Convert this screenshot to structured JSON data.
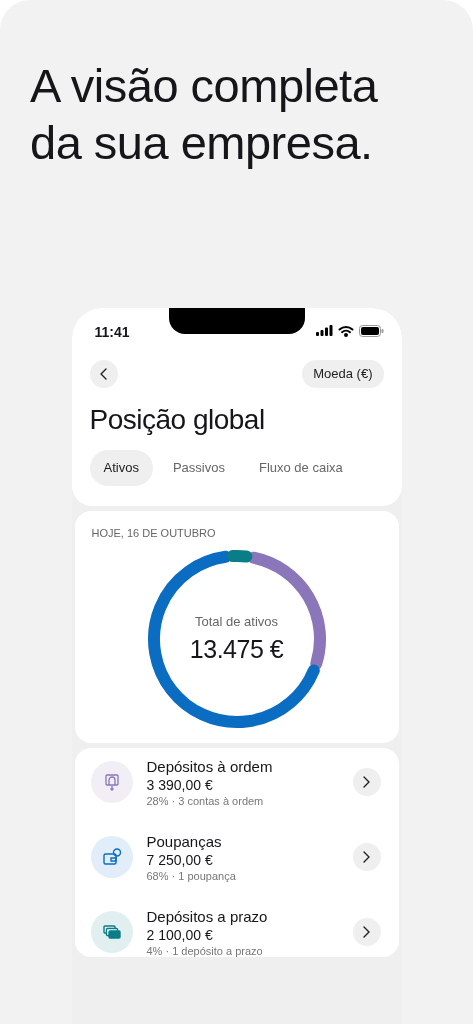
{
  "headline": "A visão completa da sua empresa.",
  "status_bar": {
    "time": "11:41"
  },
  "header": {
    "currency_button": "Moeda (€)",
    "title": "Posição global"
  },
  "tabs": [
    {
      "label": "Ativos",
      "selected": true
    },
    {
      "label": "Passivos",
      "selected": false
    },
    {
      "label": "Fluxo de caixa",
      "selected": false
    }
  ],
  "summary": {
    "date": "HOJE, 16 DE OUTUBRO",
    "total_label": "Total de ativos",
    "total": "13.475 €"
  },
  "categories": [
    {
      "kind": "current",
      "name": "Depósitos à ordem",
      "amount": "3 390,00 €",
      "detail": "28% · 3 contas à ordem",
      "color": "#8a76b8"
    },
    {
      "kind": "savings",
      "name": "Poupanças",
      "amount": "7 250,00 €",
      "detail": "68% · 1 poupança",
      "color": "#0a6dc2"
    },
    {
      "kind": "term",
      "name": "Depósitos a prazo",
      "amount": "2 100,00 €",
      "detail": "4% · 1 depósito a prazo",
      "color": "#0a7d86"
    }
  ]
}
